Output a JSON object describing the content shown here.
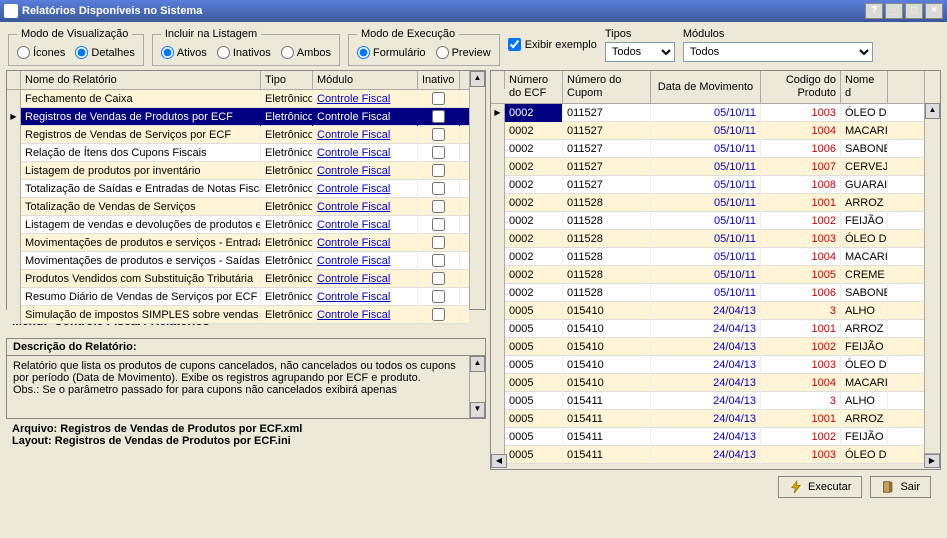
{
  "title": "Relatórios Disponíveis no Sistema",
  "groups": {
    "view_mode": {
      "legend": "Modo de Visualização",
      "icons": "Ícones",
      "details": "Detalhes"
    },
    "include": {
      "legend": "Incluir na Listagem",
      "active": "Ativos",
      "inactive": "Inativos",
      "both": "Ambos"
    },
    "exec_mode": {
      "legend": "Modo de Execução",
      "form": "Formulário",
      "preview": "Preview"
    },
    "show_example": "Exibir exemplo",
    "types": {
      "label": "Tipos",
      "value": "Todos"
    },
    "modules": {
      "label": "Módulos",
      "value": "Todos"
    }
  },
  "left_grid": {
    "headers": {
      "name": "Nome do Relatório",
      "type": "Tipo",
      "module": "Módulo",
      "inactive": "Inativo"
    },
    "rows": [
      {
        "name": "Fechamento de Caixa",
        "type": "Eletrônico",
        "module": "Controle Fiscal",
        "sel": false
      },
      {
        "name": "Registros de Vendas de Produtos por ECF",
        "type": "Eletrônico",
        "module": "Controle Fiscal",
        "sel": true
      },
      {
        "name": "Registros de Vendas de Serviços por ECF",
        "type": "Eletrônico",
        "module": "Controle Fiscal",
        "sel": false
      },
      {
        "name": "Relação de Ítens dos Cupons Fiscais",
        "type": "Eletrônico",
        "module": "Controle Fiscal",
        "sel": false
      },
      {
        "name": "Listagem de produtos por inventário",
        "type": "Eletrônico",
        "module": "Controle Fiscal",
        "sel": false
      },
      {
        "name": "Totalização de Saídas e Entradas de Notas Fiscais",
        "type": "Eletrônico",
        "module": "Controle Fiscal",
        "sel": false
      },
      {
        "name": "Totalização de Vendas de Serviços",
        "type": "Eletrônico",
        "module": "Controle Fiscal",
        "sel": false
      },
      {
        "name": "Listagem de vendas e devoluções de produtos e se",
        "type": "Eletrônico",
        "module": "Controle Fiscal",
        "sel": false
      },
      {
        "name": "Movimentações de produtos e serviços - Entradas",
        "type": "Eletrônico",
        "module": "Controle Fiscal",
        "sel": false
      },
      {
        "name": "Movimentações de produtos e serviços - Saídas",
        "type": "Eletrônico",
        "module": "Controle Fiscal",
        "sel": false
      },
      {
        "name": "Produtos Vendidos com Substituição Tributária",
        "type": "Eletrônico",
        "module": "Controle Fiscal",
        "sel": false
      },
      {
        "name": "Resumo Diário de Vendas de Serviços por ECF",
        "type": "Eletrônico",
        "module": "Controle Fiscal",
        "sel": false
      },
      {
        "name": "Simulação de impostos SIMPLES sobre vendas e d",
        "type": "Eletrônico",
        "module": "Controle Fiscal",
        "sel": false
      }
    ]
  },
  "menu_label": "Menu:",
  "menu_path": "Controle Fiscal / Relatórios",
  "desc": {
    "header": "Descrição do Relatório:",
    "body": "Relatório que lista os produtos de cupons cancelados, não cancelados ou todos os cupons por período (Data de Movimento). Exibe os registros agrupando por ECF e produto.\nObs.: Se o parâmetro passado for para cupons não cancelados exibirá apenas"
  },
  "files": {
    "arquivo_label": "Arquivo:",
    "arquivo_value": "Registros de Vendas de Produtos por ECF.xml",
    "layout_label": "Layout:",
    "layout_value": "Registros de Vendas de Produtos por ECF.ini"
  },
  "right_grid": {
    "headers": {
      "ecf": "Número do ECF",
      "cupom": "Número do Cupom",
      "data": "Data de Movimento",
      "codigo": "Codigo do Produto",
      "nome": "Nome d"
    },
    "rows": [
      {
        "ecf": "0002",
        "cupom": "011527",
        "data": "05/10/11",
        "codigo": "1003",
        "nome": "ÓLEO D",
        "sel": true
      },
      {
        "ecf": "0002",
        "cupom": "011527",
        "data": "05/10/11",
        "codigo": "1004",
        "nome": "MACARI",
        "sel": false
      },
      {
        "ecf": "0002",
        "cupom": "011527",
        "data": "05/10/11",
        "codigo": "1006",
        "nome": "SABONE",
        "sel": false
      },
      {
        "ecf": "0002",
        "cupom": "011527",
        "data": "05/10/11",
        "codigo": "1007",
        "nome": "CERVEJ",
        "sel": false
      },
      {
        "ecf": "0002",
        "cupom": "011527",
        "data": "05/10/11",
        "codigo": "1008",
        "nome": "GUARAI",
        "sel": false
      },
      {
        "ecf": "0002",
        "cupom": "011528",
        "data": "05/10/11",
        "codigo": "1001",
        "nome": "ARROZ",
        "sel": false
      },
      {
        "ecf": "0002",
        "cupom": "011528",
        "data": "05/10/11",
        "codigo": "1002",
        "nome": "FEIJÃO",
        "sel": false
      },
      {
        "ecf": "0002",
        "cupom": "011528",
        "data": "05/10/11",
        "codigo": "1003",
        "nome": "ÓLEO D",
        "sel": false
      },
      {
        "ecf": "0002",
        "cupom": "011528",
        "data": "05/10/11",
        "codigo": "1004",
        "nome": "MACARI",
        "sel": false
      },
      {
        "ecf": "0002",
        "cupom": "011528",
        "data": "05/10/11",
        "codigo": "1005",
        "nome": "CREME",
        "sel": false
      },
      {
        "ecf": "0002",
        "cupom": "011528",
        "data": "05/10/11",
        "codigo": "1006",
        "nome": "SABONE",
        "sel": false
      },
      {
        "ecf": "0005",
        "cupom": "015410",
        "data": "24/04/13",
        "codigo": "3",
        "nome": "ALHO",
        "sel": false
      },
      {
        "ecf": "0005",
        "cupom": "015410",
        "data": "24/04/13",
        "codigo": "1001",
        "nome": "ARROZ",
        "sel": false
      },
      {
        "ecf": "0005",
        "cupom": "015410",
        "data": "24/04/13",
        "codigo": "1002",
        "nome": "FEIJÃO",
        "sel": false
      },
      {
        "ecf": "0005",
        "cupom": "015410",
        "data": "24/04/13",
        "codigo": "1003",
        "nome": "ÓLEO D",
        "sel": false
      },
      {
        "ecf": "0005",
        "cupom": "015410",
        "data": "24/04/13",
        "codigo": "1004",
        "nome": "MACARI",
        "sel": false
      },
      {
        "ecf": "0005",
        "cupom": "015411",
        "data": "24/04/13",
        "codigo": "3",
        "nome": "ALHO",
        "sel": false
      },
      {
        "ecf": "0005",
        "cupom": "015411",
        "data": "24/04/13",
        "codigo": "1001",
        "nome": "ARROZ",
        "sel": false
      },
      {
        "ecf": "0005",
        "cupom": "015411",
        "data": "24/04/13",
        "codigo": "1002",
        "nome": "FEIJÃO",
        "sel": false
      },
      {
        "ecf": "0005",
        "cupom": "015411",
        "data": "24/04/13",
        "codigo": "1003",
        "nome": "ÓLEO D",
        "sel": false
      }
    ]
  },
  "buttons": {
    "execute": "Executar",
    "exit": "Sair"
  }
}
